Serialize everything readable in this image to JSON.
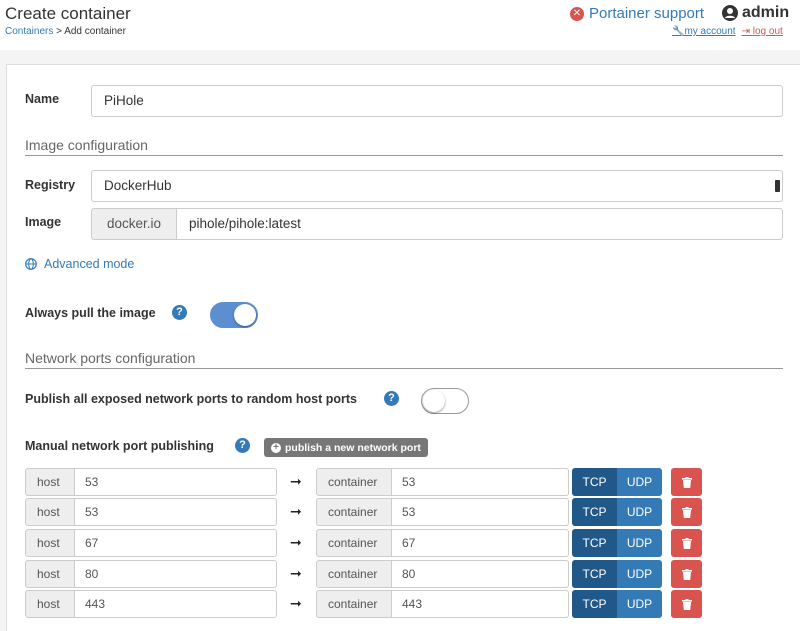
{
  "header": {
    "title": "Create container",
    "breadcrumb_link": "Containers",
    "breadcrumb_rest": " > Add container",
    "support_label": "Portainer support",
    "user_name": "admin",
    "my_account": "my account",
    "log_out": "log out"
  },
  "form": {
    "name_label": "Name",
    "name_value": "PiHole",
    "image_section_title": "Image configuration",
    "registry_label": "Registry",
    "registry_value": "DockerHub",
    "image_label": "Image",
    "image_prefix": "docker.io",
    "image_value": "pihole/pihole:latest",
    "advanced_mode": "Advanced mode",
    "always_pull_label": "Always pull the image",
    "always_pull": true,
    "network_section_title": "Network ports configuration",
    "publish_all_label": "Publish all exposed network ports to random host ports",
    "publish_all": false,
    "manual_publish_label": "Manual network port publishing",
    "publish_new_button": "publish a new network port"
  },
  "ports": [
    {
      "host_label": "host",
      "host": "53",
      "container_label": "container",
      "container": "53",
      "tcp": "TCP",
      "udp": "UDP"
    },
    {
      "host_label": "host",
      "host": "53",
      "container_label": "container",
      "container": "53",
      "tcp": "TCP",
      "udp": "UDP"
    },
    {
      "host_label": "host",
      "host": "67",
      "container_label": "container",
      "container": "67",
      "tcp": "TCP",
      "udp": "UDP"
    },
    {
      "host_label": "host",
      "host": "80",
      "container_label": "container",
      "container": "80",
      "tcp": "TCP",
      "udp": "UDP"
    },
    {
      "host_label": "host",
      "host": "443",
      "container_label": "container",
      "container": "443",
      "tcp": "TCP",
      "udp": "UDP"
    }
  ],
  "icons": {
    "support": "times-circle-icon",
    "user": "user-circle-icon",
    "account": "wrench-icon",
    "logout": "sign-out-icon",
    "advanced": "globe-icon",
    "help": "question-circle-icon",
    "publish": "plus-circle-icon",
    "arrow": "long-arrow-right-icon",
    "remove": "trash-icon"
  },
  "colors": {
    "primary": "#337ab7",
    "primary_dark": "#1f5889",
    "danger": "#d9534f",
    "toggle_on": "#5b8fd0"
  }
}
